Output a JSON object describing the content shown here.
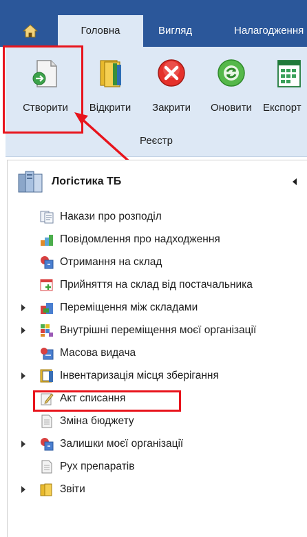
{
  "ribbon_tabs": {
    "home": "home-icon",
    "active": "Головна",
    "view": "Вигляд",
    "settings": "Налагодження"
  },
  "ribbon": {
    "buttons": [
      {
        "label": "Створити",
        "icon": "new-document-icon"
      },
      {
        "label": "Відкрити",
        "icon": "open-folder-icon"
      },
      {
        "label": "Закрити",
        "icon": "close-icon"
      },
      {
        "label": "Оновити",
        "icon": "refresh-icon"
      },
      {
        "label": "Експорт",
        "icon": "export-excel-icon"
      }
    ],
    "group_label": "Реєстр"
  },
  "panel": {
    "title": "Логістика ТБ",
    "items": [
      {
        "label": "Накази про розподіл",
        "expandable": false,
        "icon": "orders-icon"
      },
      {
        "label": "Повідомлення про надходження",
        "expandable": false,
        "icon": "notification-icon"
      },
      {
        "label": "Отримання на склад",
        "expandable": false,
        "icon": "receive-icon"
      },
      {
        "label": "Прийняття на склад від постачальника",
        "expandable": false,
        "icon": "accept-icon"
      },
      {
        "label": "Переміщення між складами",
        "expandable": true,
        "icon": "transfer-icon"
      },
      {
        "label": "Внутрішні переміщення моєї організації",
        "expandable": true,
        "icon": "internal-transfer-icon"
      },
      {
        "label": "Масова видача",
        "expandable": false,
        "icon": "mass-issue-icon"
      },
      {
        "label": "Інвентаризація місця зберігання",
        "expandable": true,
        "icon": "inventory-icon"
      },
      {
        "label": "Акт списання",
        "expandable": false,
        "icon": "write-off-icon"
      },
      {
        "label": "Зміна бюджету",
        "expandable": false,
        "icon": "document-icon"
      },
      {
        "label": "Залишки моєї організації",
        "expandable": true,
        "icon": "balance-icon"
      },
      {
        "label": "Рух препаратів",
        "expandable": false,
        "icon": "document-icon"
      },
      {
        "label": "Звіти",
        "expandable": true,
        "icon": "folder-icon"
      }
    ]
  },
  "colors": {
    "tabbar": "#2b579a",
    "ribbon": "#dde8f5",
    "highlight": "#e8141c"
  }
}
